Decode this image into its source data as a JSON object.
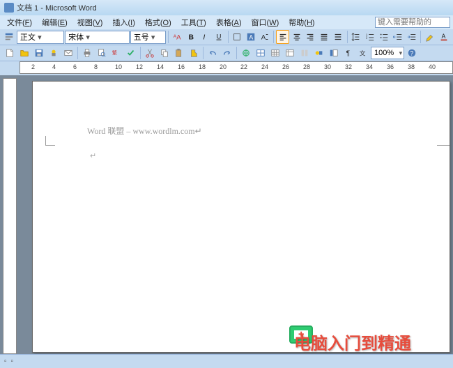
{
  "title": "文档 1 - Microsoft Word",
  "menus": {
    "file": {
      "label": "文件",
      "key": "F"
    },
    "edit": {
      "label": "编辑",
      "key": "E"
    },
    "view": {
      "label": "视图",
      "key": "V"
    },
    "insert": {
      "label": "插入",
      "key": "I"
    },
    "format": {
      "label": "格式",
      "key": "O"
    },
    "tools": {
      "label": "工具",
      "key": "T"
    },
    "table": {
      "label": "表格",
      "key": "A"
    },
    "window": {
      "label": "窗口",
      "key": "W"
    },
    "help": {
      "label": "帮助",
      "key": "H"
    }
  },
  "help_placeholder": "键入需要帮助的",
  "format_bar": {
    "style": "正文",
    "font": "宋体",
    "size": "五号"
  },
  "zoom": "100%",
  "ruler_ticks": [
    "2",
    "4",
    "6",
    "8",
    "10",
    "12",
    "14",
    "16",
    "18",
    "20",
    "22",
    "24",
    "26",
    "28",
    "30",
    "32",
    "34",
    "36",
    "38",
    "40"
  ],
  "document": {
    "header_text": "Word 联盟  – www.wordlm.com↵",
    "cursor_mark": "↵"
  },
  "watermarks": {
    "main": "电脑入门到精通",
    "url": "www.wordlm.com"
  },
  "icons": {
    "doc": "doc-icon"
  }
}
